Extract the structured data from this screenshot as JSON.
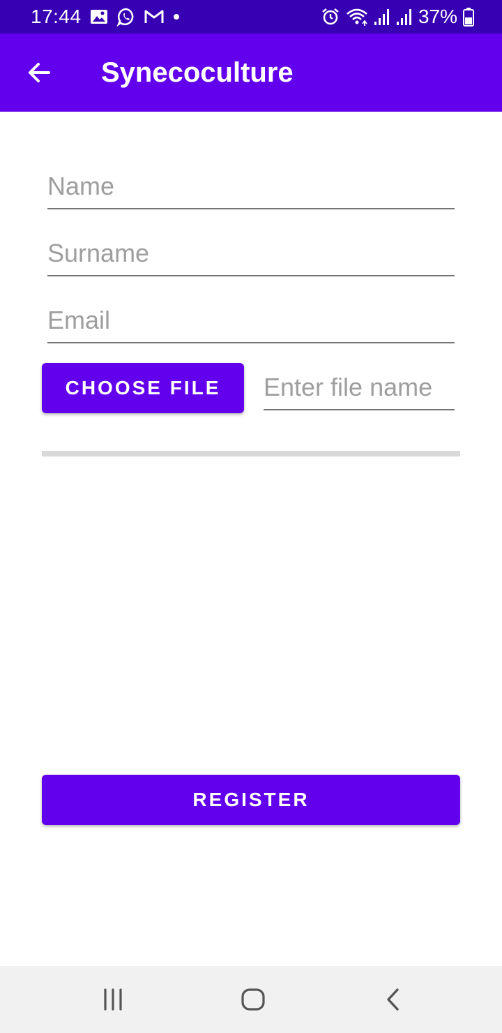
{
  "status_bar": {
    "time": "17:44",
    "battery": "37%",
    "left_icons": [
      "gallery-icon",
      "whatsapp-icon",
      "gmail-icon",
      "notification-dot-icon"
    ],
    "right_icons": [
      "alarm-icon",
      "wifi-icon",
      "signal-icon",
      "signal-icon",
      "battery-icon"
    ]
  },
  "app_bar": {
    "title": "Synecoculture",
    "back_icon": "arrow-back-icon"
  },
  "form": {
    "name_placeholder": "Name",
    "name_value": "",
    "surname_placeholder": "Surname",
    "surname_value": "",
    "email_placeholder": "Email",
    "email_value": "",
    "choose_file_label": "CHOOSE FILE",
    "file_name_placeholder": "Enter file name",
    "file_name_value": "",
    "upload_progress": 0,
    "register_label": "REGISTER"
  },
  "nav_bar": {
    "icons": [
      "recents-icon",
      "home-icon",
      "back-icon"
    ]
  },
  "colors": {
    "status_bar": "#3700b3",
    "primary": "#6200ee",
    "progress_track": "#d9d9d9",
    "nav_bar": "#f1f1f1"
  }
}
